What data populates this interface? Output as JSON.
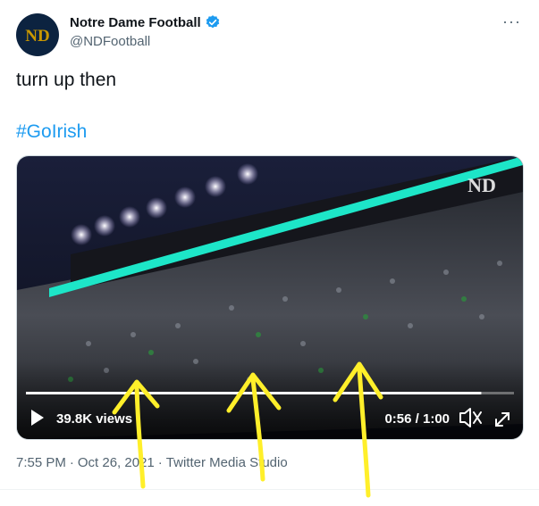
{
  "author": {
    "display_name": "Notre Dame Football",
    "handle": "@NDFootball",
    "avatar_monogram": "ND",
    "verified_icon": "verified-badge-icon",
    "brand_color": "#0c2340",
    "gold_color": "#c99700"
  },
  "tweet": {
    "text": "turn up then",
    "hashtag": "#GoIrish",
    "hashtag_color": "#1d9bf0"
  },
  "video": {
    "watermark": "ND",
    "views_label": "39.8K views",
    "time_label": "0:56 / 1:00",
    "progress": 0.933,
    "play_icon": "play-icon",
    "volume_icon": "volume-icon",
    "fullscreen_icon": "fullscreen-icon"
  },
  "meta": {
    "time": "7:55 PM",
    "separator": "·",
    "date": "Oct 26, 2021",
    "source": "Twitter Media Studio"
  },
  "menu": {
    "more_icon": "more-options-icon",
    "more_label": "···"
  }
}
